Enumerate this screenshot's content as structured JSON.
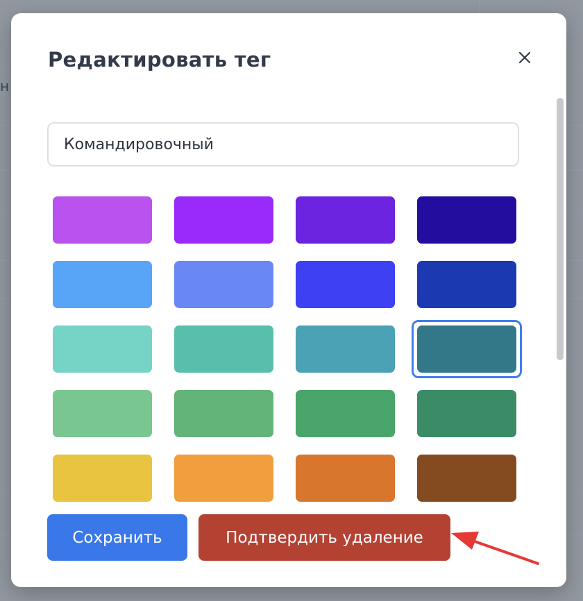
{
  "modal": {
    "title": "Редактировать тег",
    "close_icon": "close-icon"
  },
  "name_input": {
    "value": "Командировочный"
  },
  "colors": {
    "selected_index": 11,
    "swatches": [
      "#b952ef",
      "#9a2af9",
      "#6c24e0",
      "#230d9f",
      "#58a4f7",
      "#6a88f5",
      "#3e40f3",
      "#1b39b1",
      "#75d4c6",
      "#59bfad",
      "#4ba2b4",
      "#337889",
      "#7ac690",
      "#62b478",
      "#4aa56b",
      "#3b8b67",
      "#e9c441",
      "#f19e3f",
      "#d9762d",
      "#844b21"
    ]
  },
  "buttons": {
    "save_label": "Сохранить",
    "delete_label": "Подтвердить удаление"
  },
  "theme": {
    "primary": "#3a78ea",
    "danger": "#b34233",
    "selection_ring": "#3f7ee8",
    "annotation_arrow": "#e53935"
  }
}
